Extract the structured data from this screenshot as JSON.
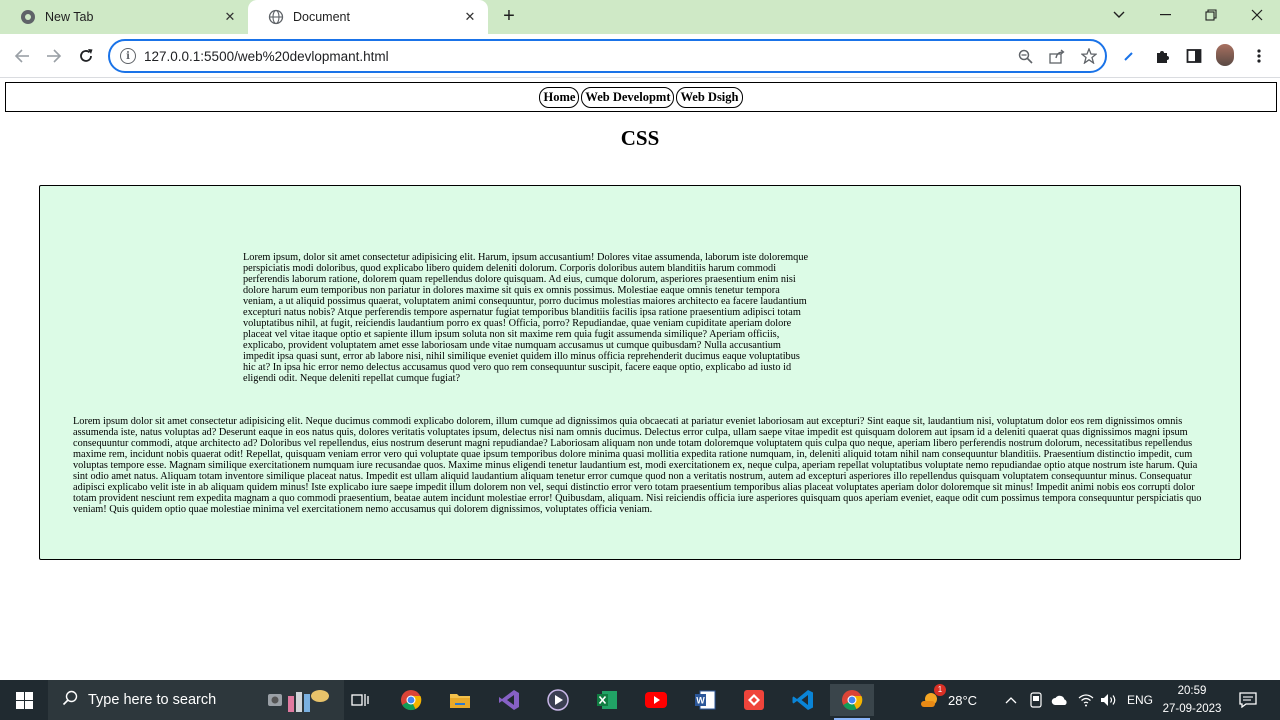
{
  "browser": {
    "tabs": [
      {
        "label": "New Tab",
        "active": false,
        "icon": "chrome-icon"
      },
      {
        "label": "Document",
        "active": true,
        "icon": "globe-icon"
      }
    ],
    "url": "127.0.0.1:5500/web%20devlopmant.html"
  },
  "page": {
    "nav": [
      "Home",
      "Web Developmt",
      "Web Dsigh"
    ],
    "heading": "CSS",
    "paragraph1": "Lorem ipsum, dolor sit amet consectetur adipisicing elit. Harum, ipsum accusantium! Dolores vitae assumenda, laborum iste doloremque perspiciatis modi doloribus, quod explicabo libero quidem deleniti dolorum. Corporis doloribus autem blanditiis harum commodi perferendis laborum ratione, dolorem quam repellendus dolore quisquam. Ad eius, cumque dolorum, asperiores praesentium enim nisi dolore harum eum temporibus non pariatur in dolores maxime sit quis ex omnis possimus. Molestiae eaque omnis tenetur tempora veniam, a ut aliquid possimus quaerat, voluptatem animi consequuntur, porro ducimus molestias maiores architecto ea facere laudantium excepturi natus nobis? Atque perferendis tempore aspernatur fugiat temporibus blanditiis facilis ipsa ratione praesentium adipisci totam voluptatibus nihil, at fugit, reiciendis laudantium porro ex quas! Officia, porro? Repudiandae, quae veniam cupiditate aperiam dolore placeat vel vitae itaque optio et sapiente illum ipsum soluta non sit maxime rem quia fugit assumenda similique? Aperiam officiis, explicabo, provident voluptatem amet esse laboriosam unde vitae numquam accusamus ut cumque quibusdam? Nulla accusantium impedit ipsa quasi sunt, error ab labore nisi, nihil similique eveniet quidem illo minus officia reprehenderit ducimus eaque voluptatibus hic at? In ipsa hic error nemo delectus accusamus quod vero quo rem consequuntur suscipit, facere eaque optio, explicabo ad iusto id eligendi odit. Neque deleniti repellat cumque fugiat?",
    "paragraph2": "Lorem ipsum dolor sit amet consectetur adipisicing elit. Neque ducimus commodi explicabo dolorem, illum cumque ad dignissimos quia obcaecati at pariatur eveniet laboriosam aut excepturi? Sint eaque sit, laudantium nisi, voluptatum dolor eos rem dignissimos omnis assumenda iste, natus voluptas ad? Deserunt eaque in eos natus quis, dolores veritatis voluptates ipsum, delectus nisi nam omnis ducimus. Delectus error culpa, ullam saepe vitae impedit est quisquam dolorem aut ipsam id a deleniti quaerat quas dignissimos magni ipsum consequuntur commodi, atque architecto ad? Doloribus vel repellendus, eius nostrum deserunt magni repudiandae? Laboriosam aliquam non unde totam doloremque voluptatem quis culpa quo neque, aperiam libero perferendis nostrum dolorum, necessitatibus repellendus maxime rem, incidunt nobis quaerat odit! Repellat, quisquam veniam error vero qui voluptate quae ipsum temporibus dolore minima quasi mollitia expedita ratione numquam, in, deleniti aliquid totam nihil nam consequuntur blanditiis. Praesentium distinctio impedit, cum voluptas tempore esse. Magnam similique exercitationem numquam iure recusandae quos. Maxime minus eligendi tenetur laudantium est, modi exercitationem ex, neque culpa, aperiam repellat voluptatibus voluptate nemo repudiandae optio atque nostrum iste harum. Quia sint odio amet natus. Aliquam totam inventore similique placeat natus. Impedit est ullam aliquid laudantium aliquam tenetur error cumque quod non a veritatis nostrum, autem ad excepturi asperiores illo repellendus quisquam voluptatem consequuntur minus. Consequatur adipisci explicabo velit iste in ab aliquam quidem minus! Iste explicabo iure saepe impedit illum dolorem non vel, sequi distinctio error vero totam praesentium temporibus alias placeat voluptates aperiam dolor doloremque sit minus! Impedit animi nobis eos corrupti dolor totam provident nesciunt rem expedita magnam a quo commodi praesentium, beatae autem incidunt molestiae error! Quibusdam, aliquam. Nisi reiciendis officia iure asperiores quisquam quos aperiam eveniet, eaque odit cum possimus tempora consequuntur perspiciatis quo veniam! Quis quidem optio quae molestiae minima vel exercitationem nemo accusamus qui dolorem dignissimos, voluptates officia veniam."
  },
  "taskbar": {
    "search_placeholder": "Type here to search",
    "weather": "28°C",
    "weather_badge": "1",
    "language": "ENG",
    "time": "20:59",
    "date": "27-09-2023"
  },
  "colors": {
    "tabstrip": "#cfe9c6",
    "content_box": "#dcfbe6",
    "omnibox_focus": "#1a73e8",
    "taskbar": "#202a30"
  }
}
